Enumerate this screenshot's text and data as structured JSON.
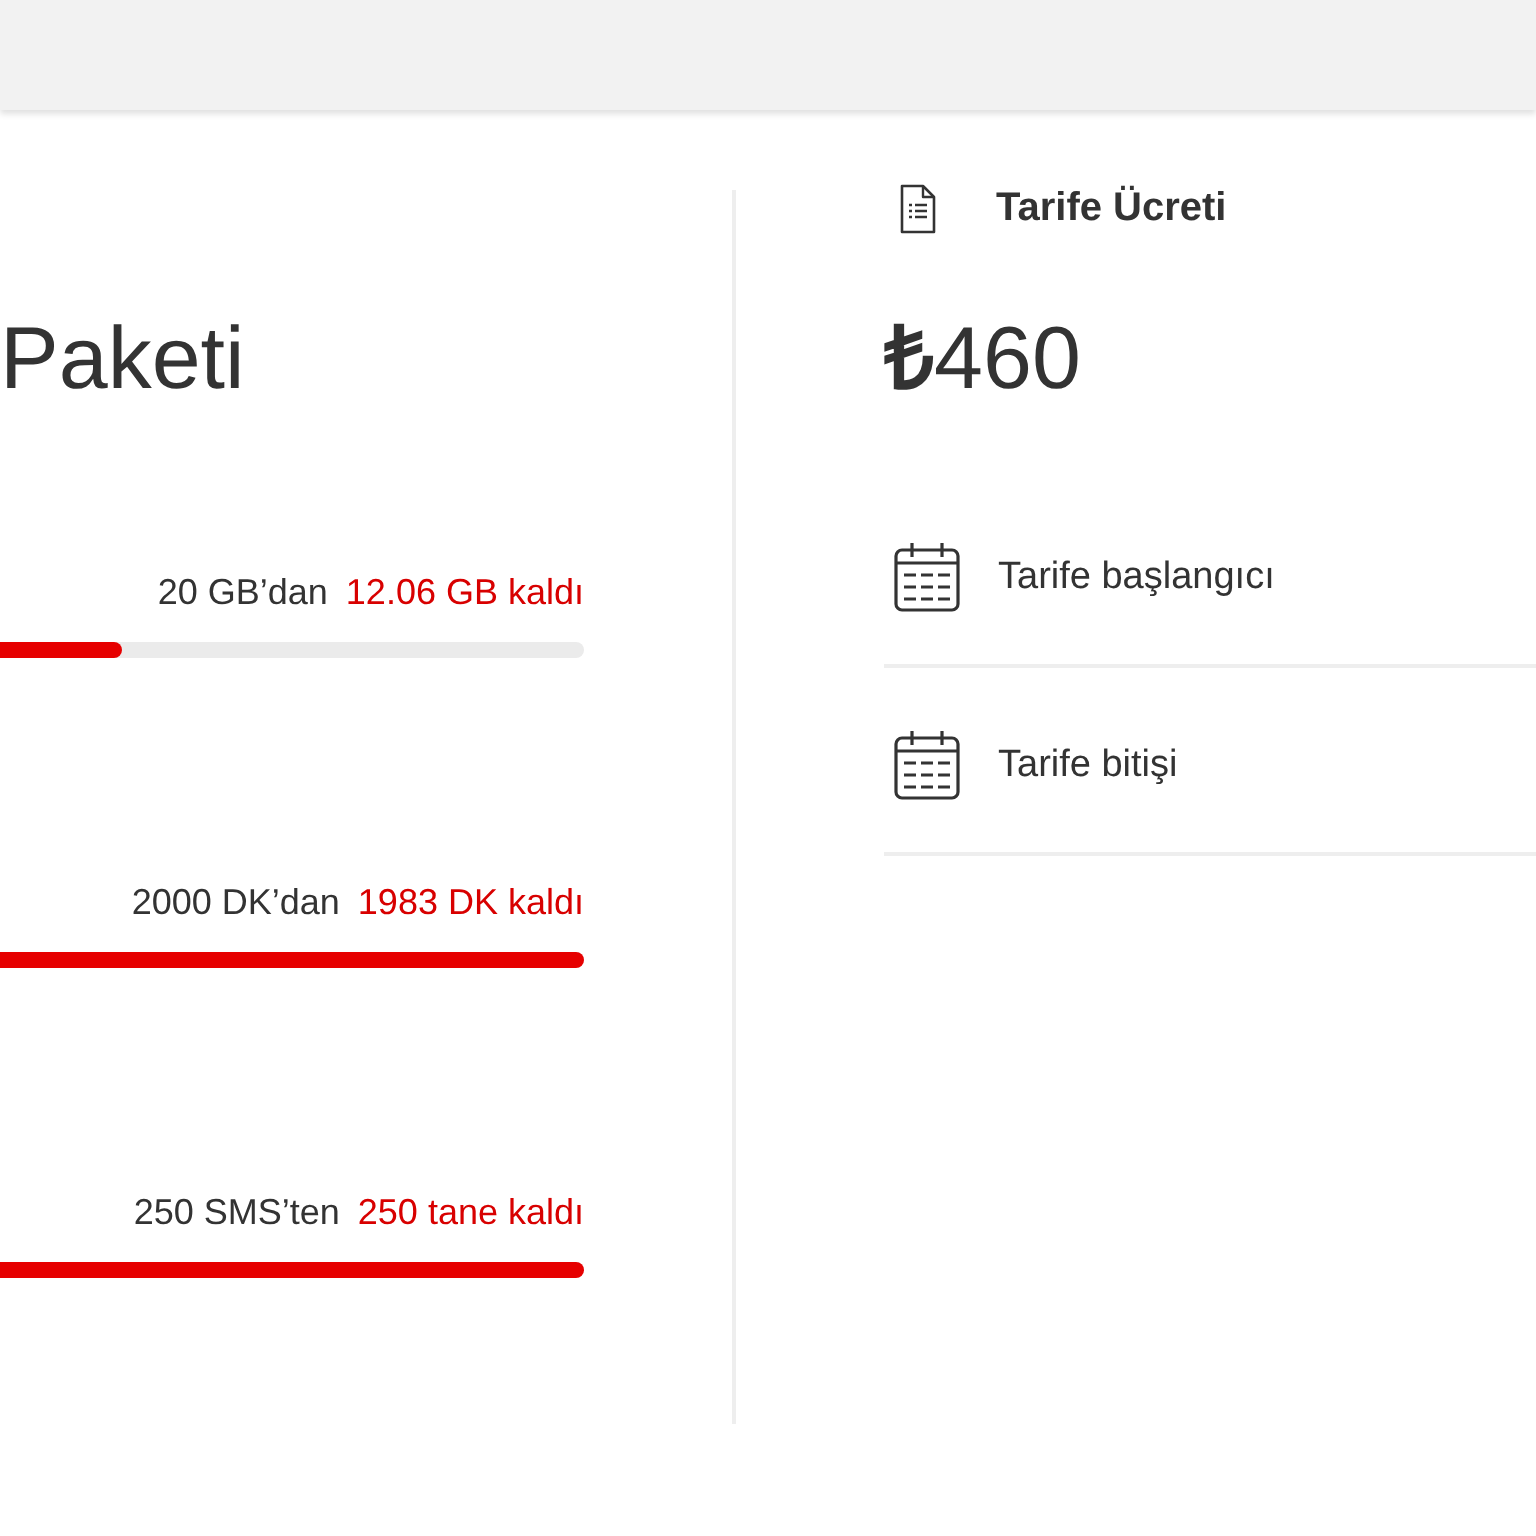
{
  "package": {
    "title": "Paketi",
    "allowances": [
      {
        "total": "20 GB’dan",
        "remaining": "12.06 GB kaldı",
        "level": 0.21
      },
      {
        "total": "2000 DK’dan",
        "remaining": "1983 DK kaldı",
        "level": 1
      },
      {
        "total": "250 SMS’ten",
        "remaining": "250 tane kaldı",
        "level": 1
      }
    ]
  },
  "tariff": {
    "fee_label": "Tarife Ücreti",
    "fee": "**₺**460",
    "dates": [
      {
        "label": "Tarife başlangıcı"
      },
      {
        "label": "Tarife bitişi"
      }
    ]
  }
}
